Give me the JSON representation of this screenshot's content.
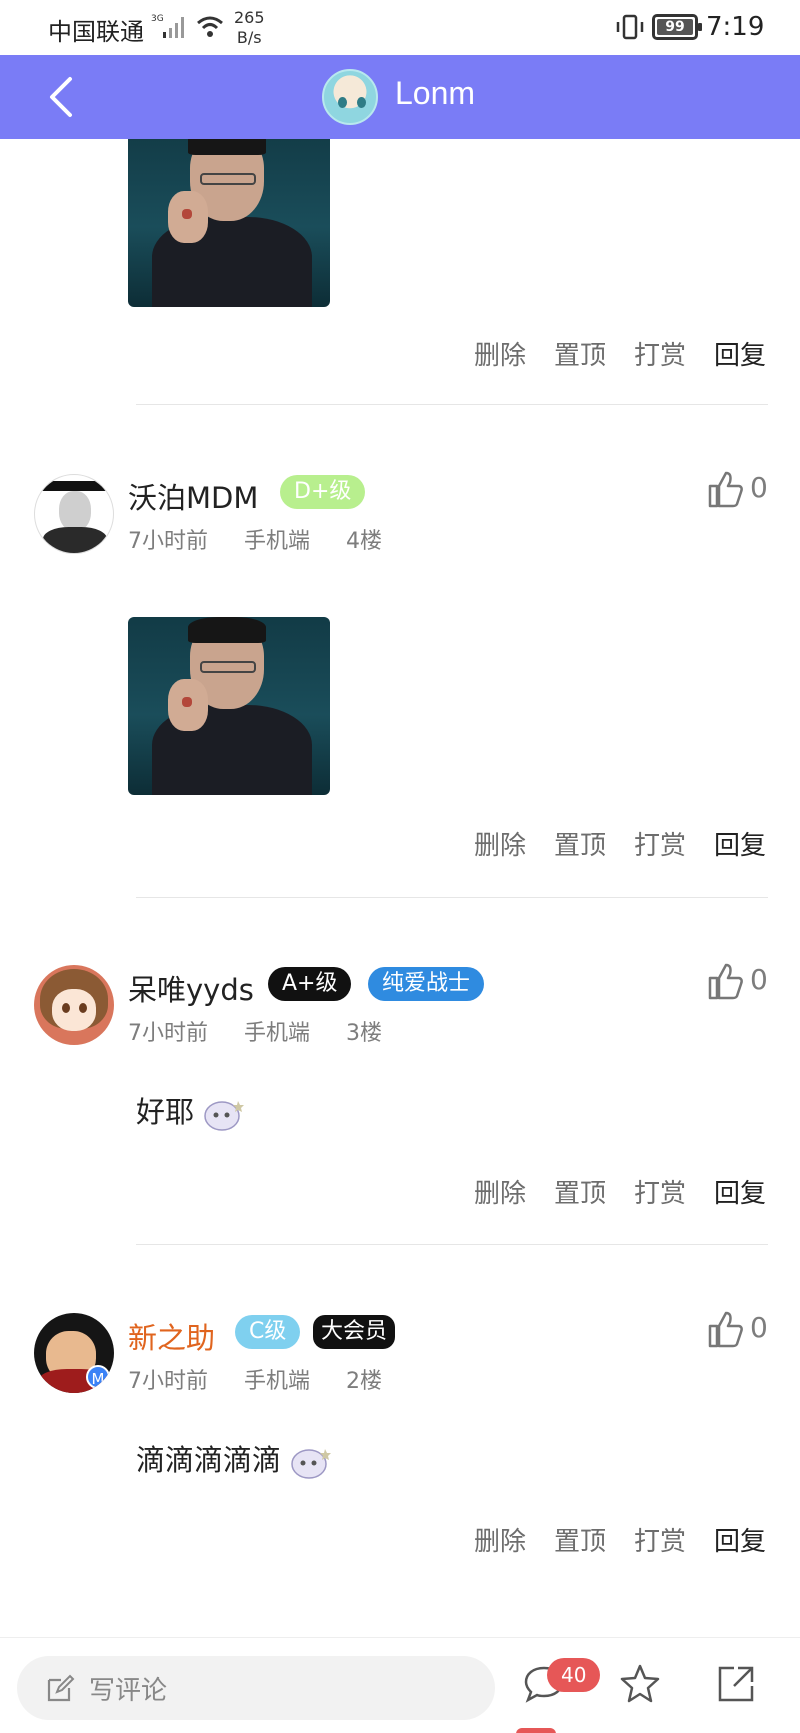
{
  "status": {
    "carrier": "中国联通",
    "speed_value": "265",
    "speed_unit": "B/s",
    "battery": "99",
    "time": "7:19"
  },
  "header": {
    "title": "Lonm"
  },
  "actions": {
    "delete": "删除",
    "pin": "置顶",
    "tip": "打赏",
    "reply": "回复"
  },
  "comments": [
    {
      "username": "沃泊MDM",
      "badges": [
        "D+级"
      ],
      "time": "7小时前",
      "device": "手机端",
      "floor": "4楼",
      "likes": "0",
      "text": ""
    },
    {
      "username": "呆唯yyds",
      "badges": [
        "A+级",
        "纯爱战士"
      ],
      "time": "7小时前",
      "device": "手机端",
      "floor": "3楼",
      "likes": "0",
      "text": "好耶"
    },
    {
      "username": "新之助",
      "badges": [
        "C级",
        "大会员"
      ],
      "time": "7小时前",
      "device": "手机端",
      "floor": "2楼",
      "likes": "0",
      "text": "滴滴滴滴滴"
    }
  ],
  "bottom": {
    "placeholder": "写评论",
    "comment_count": "40"
  },
  "icons": {
    "back": "chevron-left-icon",
    "like": "thumbs-up-icon",
    "comment": "speech-bubble-icon",
    "favorite": "star-icon",
    "share": "share-icon",
    "edit": "pencil-icon"
  }
}
